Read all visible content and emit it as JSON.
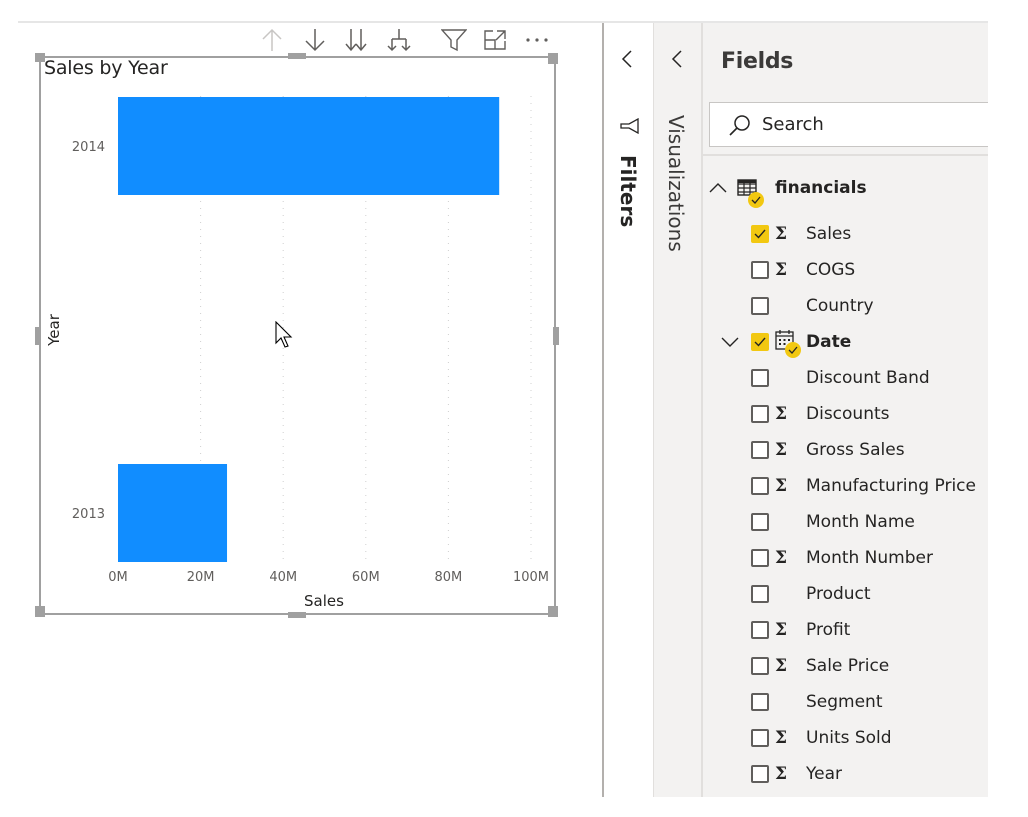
{
  "visual": {
    "toolbar": [
      {
        "name": "drill-up",
        "icon": "arrow-up-icon",
        "enabled": false
      },
      {
        "name": "drill-down",
        "icon": "arrow-down-icon",
        "enabled": true
      },
      {
        "name": "next-level",
        "icon": "double-arrow-down-icon",
        "enabled": true
      },
      {
        "name": "expand-all",
        "icon": "fork-down-icon",
        "enabled": true
      },
      {
        "name": "filter",
        "icon": "filter-icon",
        "enabled": true
      },
      {
        "name": "focus-mode",
        "icon": "focus-mode-icon",
        "enabled": true
      },
      {
        "name": "more-options",
        "icon": "more-options-icon",
        "enabled": true
      }
    ]
  },
  "chart_data": {
    "type": "bar",
    "orientation": "horizontal",
    "title": "Sales by Year",
    "xlabel": "Sales",
    "ylabel": "Year",
    "categories": [
      "2014",
      "2013"
    ],
    "values": [
      92300000,
      26400000
    ],
    "xlim": [
      0,
      100000000
    ],
    "xticks": [
      0,
      20000000,
      40000000,
      60000000,
      80000000,
      100000000
    ],
    "xtick_labels": [
      "0M",
      "20M",
      "40M",
      "60M",
      "80M",
      "100M"
    ],
    "grid": "vertical dotted",
    "color": "#118dff"
  },
  "panes": {
    "filters_label": "Filters",
    "visualizations_label": "Visualizations"
  },
  "fields": {
    "title": "Fields",
    "search_placeholder": "Search",
    "table": {
      "name": "financials",
      "expanded": true,
      "has_selected": true
    },
    "items": [
      {
        "label": "Sales",
        "sigma": true,
        "checked": true
      },
      {
        "label": "COGS",
        "sigma": true,
        "checked": false
      },
      {
        "label": "Country",
        "sigma": false,
        "checked": false
      },
      {
        "label": "Date",
        "type": "date-hierarchy",
        "checked": true,
        "collapsed": true
      },
      {
        "label": "Discount Band",
        "sigma": false,
        "checked": false
      },
      {
        "label": "Discounts",
        "sigma": true,
        "checked": false
      },
      {
        "label": "Gross Sales",
        "sigma": true,
        "checked": false
      },
      {
        "label": "Manufacturing Price",
        "sigma": true,
        "checked": false
      },
      {
        "label": "Month Name",
        "sigma": false,
        "checked": false
      },
      {
        "label": "Month Number",
        "sigma": true,
        "checked": false
      },
      {
        "label": "Product",
        "sigma": false,
        "checked": false
      },
      {
        "label": "Profit",
        "sigma": true,
        "checked": false
      },
      {
        "label": "Sale Price",
        "sigma": true,
        "checked": false
      },
      {
        "label": "Segment",
        "sigma": false,
        "checked": false
      },
      {
        "label": "Units Sold",
        "sigma": true,
        "checked": false
      },
      {
        "label": "Year",
        "sigma": true,
        "checked": false
      }
    ]
  },
  "colors": {
    "accent_yellow": "#f2c811",
    "bar_blue": "#118dff",
    "pane_bg": "#f3f2f1"
  }
}
